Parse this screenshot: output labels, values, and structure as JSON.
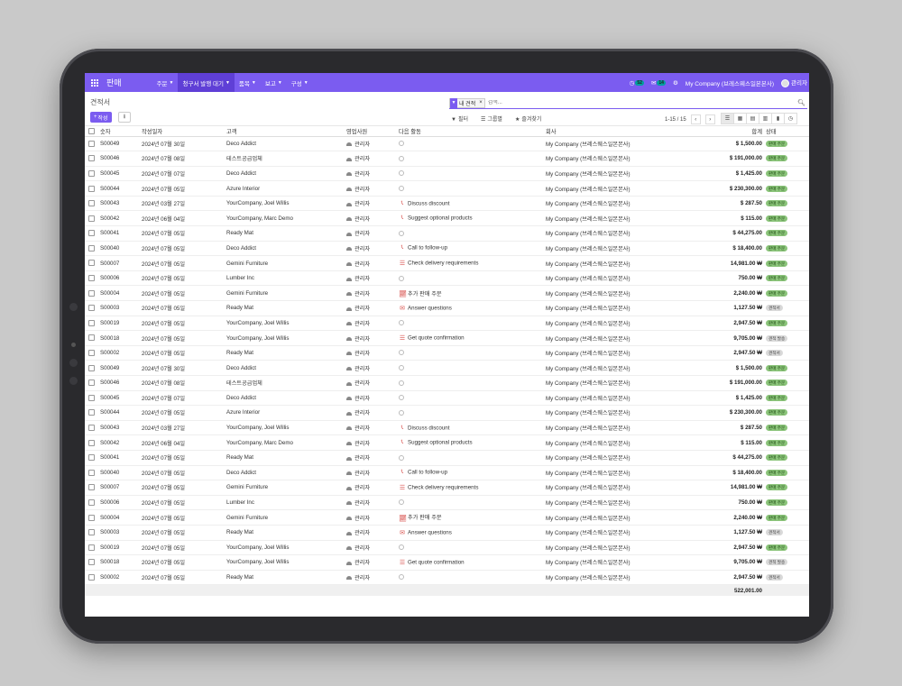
{
  "app": {
    "name": "판매"
  },
  "nav": {
    "menus": [
      {
        "label": "주문",
        "active": false
      },
      {
        "label": "청구서 발행 대기",
        "active": true
      },
      {
        "label": "품목",
        "active": false
      },
      {
        "label": "보고",
        "active": false
      },
      {
        "label": "구성",
        "active": false
      }
    ],
    "activity_count": "52",
    "message_count": "14",
    "company": "My Company (브레스웨스일본본사)",
    "user": "관리자"
  },
  "control": {
    "breadcrumb": "견적서",
    "create_label": "작성",
    "facet_label": "내 견적",
    "search_placeholder": "검색...",
    "filters_label": "필터",
    "groupby_label": "그룹별",
    "favorites_label": "즐겨찾기",
    "pager": "1-15 / 15"
  },
  "table": {
    "headers": {
      "number": "숫자",
      "date": "작성일자",
      "customer": "고객",
      "salesperson": "영업사원",
      "activity": "다음 활동",
      "company": "회사",
      "total": "합계",
      "status": "상태"
    },
    "rows": [
      {
        "number": "S00049",
        "date": "2024년 07월 30일",
        "customer": "Deco Addict",
        "salesperson": "관리자",
        "activity": "",
        "activity_icon": "none",
        "company": "My Company (브레스웨스일본본사)",
        "total": "$ 1,500.00",
        "status": "판매 주문",
        "status_color": "green"
      },
      {
        "number": "S00046",
        "date": "2024년 07월 08일",
        "customer": "테스트공급업체",
        "salesperson": "관리자",
        "activity": "",
        "activity_icon": "none",
        "company": "My Company (브레스웨스일본본사)",
        "total": "$ 191,000.00",
        "status": "판매 주문",
        "status_color": "green"
      },
      {
        "number": "S00045",
        "date": "2024년 07월 07일",
        "customer": "Deco Addict",
        "salesperson": "관리자",
        "activity": "",
        "activity_icon": "none",
        "company": "My Company (브레스웨스일본본사)",
        "total": "$ 1,425.00",
        "status": "판매 주문",
        "status_color": "green"
      },
      {
        "number": "S00044",
        "date": "2024년 07월 05일",
        "customer": "Azure Interior",
        "salesperson": "관리자",
        "activity": "",
        "activity_icon": "none",
        "company": "My Company (브레스웨스일본본사)",
        "total": "$ 230,300.00",
        "status": "판매 주문",
        "status_color": "green"
      },
      {
        "number": "S00043",
        "date": "2024년 03월 27일",
        "customer": "YourCompany, Joel Willis",
        "salesperson": "관리자",
        "activity": "Discuss discount",
        "activity_icon": "phone",
        "company": "My Company (브레스웨스일본본사)",
        "total": "$ 287.50",
        "status": "판매 주문",
        "status_color": "green"
      },
      {
        "number": "S00042",
        "date": "2024년 06월 04일",
        "customer": "YourCompany, Marc Demo",
        "salesperson": "관리자",
        "activity": "Suggest optional products",
        "activity_icon": "phone",
        "company": "My Company (브레스웨스일본본사)",
        "total": "$ 115.00",
        "status": "판매 주문",
        "status_color": "green"
      },
      {
        "number": "S00041",
        "date": "2024년 07월 05일",
        "customer": "Ready Mat",
        "salesperson": "관리자",
        "activity": "",
        "activity_icon": "none",
        "company": "My Company (브레스웨스일본본사)",
        "total": "$ 44,275.00",
        "status": "판매 주문",
        "status_color": "green"
      },
      {
        "number": "S00040",
        "date": "2024년 07월 05일",
        "customer": "Deco Addict",
        "salesperson": "관리자",
        "activity": "Call to follow-up",
        "activity_icon": "phone",
        "company": "My Company (브레스웨스일본본사)",
        "total": "$ 18,400.00",
        "status": "판매 주문",
        "status_color": "green"
      },
      {
        "number": "S00007",
        "date": "2024년 07월 05일",
        "customer": "Gemini Furniture",
        "salesperson": "관리자",
        "activity": "Check delivery requirements",
        "activity_icon": "list",
        "company": "My Company (브레스웨스일본본사)",
        "total": "14,981.00 ₩",
        "status": "판매 주문",
        "status_color": "green"
      },
      {
        "number": "S00006",
        "date": "2024년 07월 05일",
        "customer": "Lumber Inc",
        "salesperson": "관리자",
        "activity": "",
        "activity_icon": "none",
        "company": "My Company (브레스웨스일본본사)",
        "total": "750.00 ₩",
        "status": "판매 주문",
        "status_color": "green"
      },
      {
        "number": "S00004",
        "date": "2024년 07월 05일",
        "customer": "Gemini Furniture",
        "salesperson": "관리자",
        "activity": "추가 판매 주문",
        "activity_icon": "chart",
        "company": "My Company (브레스웨스일본본사)",
        "total": "2,240.00 ₩",
        "status": "판매 주문",
        "status_color": "green"
      },
      {
        "number": "S00003",
        "date": "2024년 07월 05일",
        "customer": "Ready Mat",
        "salesperson": "관리자",
        "activity": "Answer questions",
        "activity_icon": "mail",
        "company": "My Company (브레스웨스일본본사)",
        "total": "1,127.50 ₩",
        "status": "견적서",
        "status_color": "gray"
      },
      {
        "number": "S00019",
        "date": "2024년 07월 05일",
        "customer": "YourCompany, Joel Willis",
        "salesperson": "관리자",
        "activity": "",
        "activity_icon": "none",
        "company": "My Company (브레스웨스일본본사)",
        "total": "2,947.50 ₩",
        "status": "판매 주문",
        "status_color": "green"
      },
      {
        "number": "S00018",
        "date": "2024년 07월 05일",
        "customer": "YourCompany, Joel Willis",
        "salesperson": "관리자",
        "activity": "Get quote confirmation",
        "activity_icon": "list",
        "company": "My Company (브레스웨스일본본사)",
        "total": "9,705.00 ₩",
        "status": "견적 발송",
        "status_color": "gray"
      },
      {
        "number": "S00002",
        "date": "2024년 07월 05일",
        "customer": "Ready Mat",
        "salesperson": "관리자",
        "activity": "",
        "activity_icon": "none",
        "company": "My Company (브레스웨스일본본사)",
        "total": "2,947.50 ₩",
        "status": "견적서",
        "status_color": "gray"
      },
      {
        "number": "S00049",
        "date": "2024년 07월 30일",
        "customer": "Deco Addict",
        "salesperson": "관리자",
        "activity": "",
        "activity_icon": "none",
        "company": "My Company (브레스웨스일본본사)",
        "total": "$ 1,500.00",
        "status": "판매 주문",
        "status_color": "green"
      },
      {
        "number": "S00046",
        "date": "2024년 07월 08일",
        "customer": "테스트공급업체",
        "salesperson": "관리자",
        "activity": "",
        "activity_icon": "none",
        "company": "My Company (브레스웨스일본본사)",
        "total": "$ 191,000.00",
        "status": "판매 주문",
        "status_color": "green"
      },
      {
        "number": "S00045",
        "date": "2024년 07월 07일",
        "customer": "Deco Addict",
        "salesperson": "관리자",
        "activity": "",
        "activity_icon": "none",
        "company": "My Company (브레스웨스일본본사)",
        "total": "$ 1,425.00",
        "status": "판매 주문",
        "status_color": "green"
      },
      {
        "number": "S00044",
        "date": "2024년 07월 05일",
        "customer": "Azure Interior",
        "salesperson": "관리자",
        "activity": "",
        "activity_icon": "none",
        "company": "My Company (브레스웨스일본본사)",
        "total": "$ 230,300.00",
        "status": "판매 주문",
        "status_color": "green"
      },
      {
        "number": "S00043",
        "date": "2024년 03월 27일",
        "customer": "YourCompany, Joel Willis",
        "salesperson": "관리자",
        "activity": "Discuss discount",
        "activity_icon": "phone",
        "company": "My Company (브레스웨스일본본사)",
        "total": "$ 287.50",
        "status": "판매 주문",
        "status_color": "green"
      },
      {
        "number": "S00042",
        "date": "2024년 06월 04일",
        "customer": "YourCompany, Marc Demo",
        "salesperson": "관리자",
        "activity": "Suggest optional products",
        "activity_icon": "phone",
        "company": "My Company (브레스웨스일본본사)",
        "total": "$ 115.00",
        "status": "판매 주문",
        "status_color": "green"
      },
      {
        "number": "S00041",
        "date": "2024년 07월 05일",
        "customer": "Ready Mat",
        "salesperson": "관리자",
        "activity": "",
        "activity_icon": "none",
        "company": "My Company (브레스웨스일본본사)",
        "total": "$ 44,275.00",
        "status": "판매 주문",
        "status_color": "green"
      },
      {
        "number": "S00040",
        "date": "2024년 07월 05일",
        "customer": "Deco Addict",
        "salesperson": "관리자",
        "activity": "Call to follow-up",
        "activity_icon": "phone",
        "company": "My Company (브레스웨스일본본사)",
        "total": "$ 18,400.00",
        "status": "판매 주문",
        "status_color": "green"
      },
      {
        "number": "S00007",
        "date": "2024년 07월 05일",
        "customer": "Gemini Furniture",
        "salesperson": "관리자",
        "activity": "Check delivery requirements",
        "activity_icon": "list",
        "company": "My Company (브레스웨스일본본사)",
        "total": "14,981.00 ₩",
        "status": "판매 주문",
        "status_color": "green"
      },
      {
        "number": "S00006",
        "date": "2024년 07월 05일",
        "customer": "Lumber Inc",
        "salesperson": "관리자",
        "activity": "",
        "activity_icon": "none",
        "company": "My Company (브레스웨스일본본사)",
        "total": "750.00 ₩",
        "status": "판매 주문",
        "status_color": "green"
      },
      {
        "number": "S00004",
        "date": "2024년 07월 05일",
        "customer": "Gemini Furniture",
        "salesperson": "관리자",
        "activity": "추가 판매 주문",
        "activity_icon": "chart",
        "company": "My Company (브레스웨스일본본사)",
        "total": "2,240.00 ₩",
        "status": "판매 주문",
        "status_color": "green"
      },
      {
        "number": "S00003",
        "date": "2024년 07월 05일",
        "customer": "Ready Mat",
        "salesperson": "관리자",
        "activity": "Answer questions",
        "activity_icon": "mail",
        "company": "My Company (브레스웨스일본본사)",
        "total": "1,127.50 ₩",
        "status": "견적서",
        "status_color": "gray"
      },
      {
        "number": "S00019",
        "date": "2024년 07월 05일",
        "customer": "YourCompany, Joel Willis",
        "salesperson": "관리자",
        "activity": "",
        "activity_icon": "none",
        "company": "My Company (브레스웨스일본본사)",
        "total": "2,947.50 ₩",
        "status": "판매 주문",
        "status_color": "green"
      },
      {
        "number": "S00018",
        "date": "2024년 07월 05일",
        "customer": "YourCompany, Joel Willis",
        "salesperson": "관리자",
        "activity": "Get quote confirmation",
        "activity_icon": "list",
        "company": "My Company (브레스웨스일본본사)",
        "total": "9,705.00 ₩",
        "status": "견적 발송",
        "status_color": "gray"
      },
      {
        "number": "S00002",
        "date": "2024년 07월 05일",
        "customer": "Ready Mat",
        "salesperson": "관리자",
        "activity": "",
        "activity_icon": "none",
        "company": "My Company (브레스웨스일본본사)",
        "total": "2,947.50 ₩",
        "status": "견적서",
        "status_color": "gray"
      }
    ],
    "grand_total": "522,001.00"
  },
  "colors": {
    "brand": "#7b5cf0",
    "brand_dark": "#5f3fd6",
    "badge_green": "#8bc47a",
    "badge_gray": "#d9d9d9"
  }
}
